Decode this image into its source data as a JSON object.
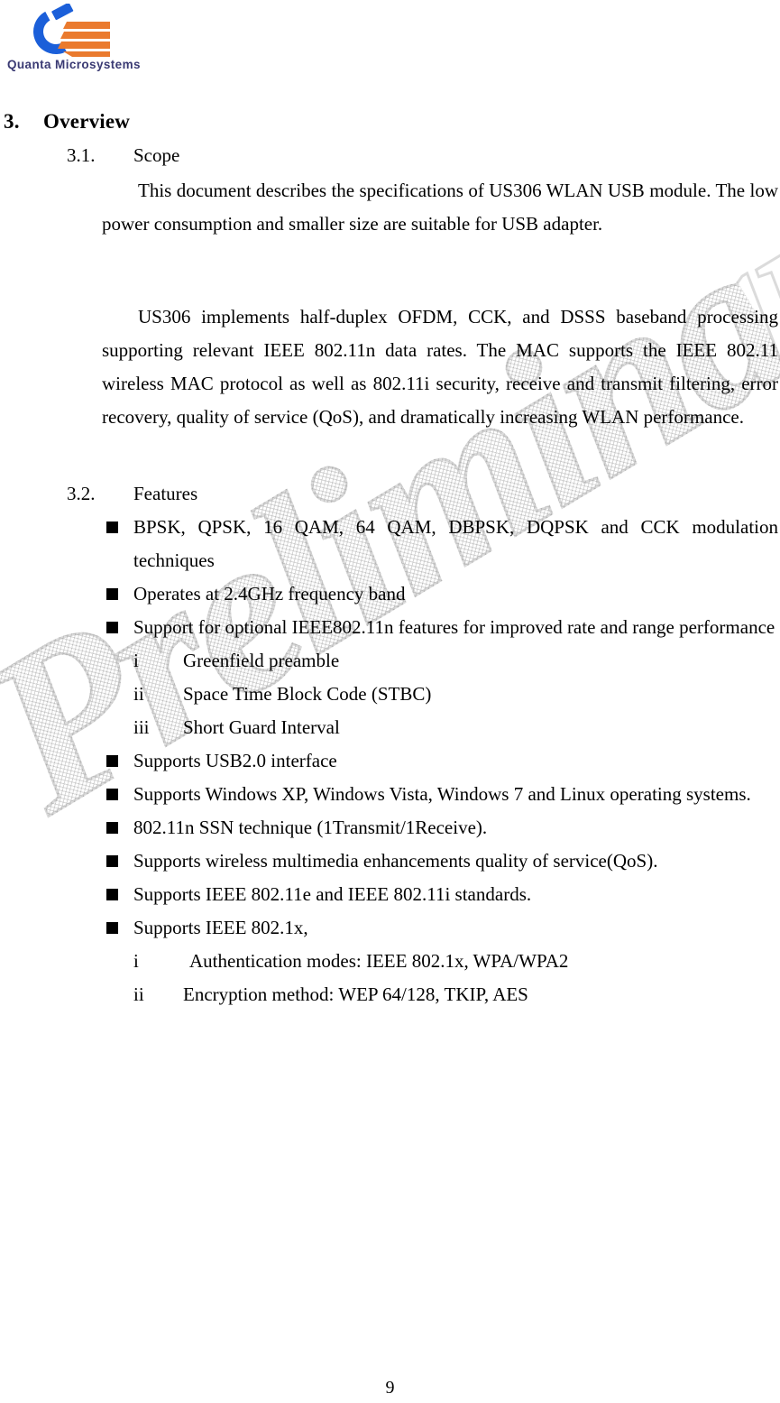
{
  "brand": {
    "wordmark": "Quanta Microsystems",
    "logo_blue": "#1b5fd9",
    "logo_orange": "#ea7a2e",
    "wordmark_color": "#3a3a73"
  },
  "watermark": {
    "text": "Preliminary"
  },
  "section": {
    "number": "3.",
    "title": "Overview"
  },
  "scope": {
    "number": "3.1.",
    "title": "Scope",
    "paragraph_1": "This document describes the specifications of US306 WLAN USB module. The low power consumption and smaller size are suitable for USB adapter.",
    "paragraph_2": "US306 implements half-duplex OFDM, CCK, and DSSS baseband processing supporting relevant IEEE 802.11n data rates. The MAC supports the IEEE 802.11 wireless MAC protocol as well as 802.11i security, receive and transmit filtering, error recovery, quality of service (QoS), and dramatically increasing WLAN performance."
  },
  "features": {
    "number": "3.2.",
    "title": "Features",
    "items": [
      {
        "text": "BPSK, QPSK, 16 QAM, 64 QAM, DBPSK, DQPSK and CCK modulation techniques",
        "justify": true,
        "sub": []
      },
      {
        "text": "Operates at 2.4GHz frequency band",
        "justify": false,
        "sub": []
      },
      {
        "text": "Support for optional IEEE802.11n features for improved rate and range performance",
        "justify": true,
        "sub": [
          {
            "marker": "i",
            "text": "Greenfield preamble"
          },
          {
            "marker": "ii",
            "text": "Space Time Block Code (STBC)"
          },
          {
            "marker": "iii",
            "text": "Short Guard Interval"
          }
        ]
      },
      {
        "text": "Supports USB2.0 interface",
        "justify": false,
        "sub": []
      },
      {
        "text": "Supports Windows XP, Windows Vista, Windows 7 and Linux operating systems.",
        "justify": true,
        "sub": []
      },
      {
        "text": "802.11n SSN technique (1Transmit/1Receive).",
        "justify": false,
        "sub": []
      },
      {
        "text": "Supports wireless multimedia enhancements quality of service(QoS).",
        "justify": false,
        "sub": []
      },
      {
        "text": "Supports IEEE 802.11e and IEEE 802.11i standards.",
        "justify": false,
        "sub": []
      },
      {
        "text": "Supports IEEE 802.1x,",
        "justify": false,
        "sub": [
          {
            "marker": "i",
            "text": "Authentication modes: IEEE 802.1x, WPA/WPA2"
          },
          {
            "marker": "ii",
            "text": "Encryption method: WEP 64/128, TKIP, AES"
          }
        ]
      }
    ]
  },
  "footer": {
    "page_number": "9"
  }
}
